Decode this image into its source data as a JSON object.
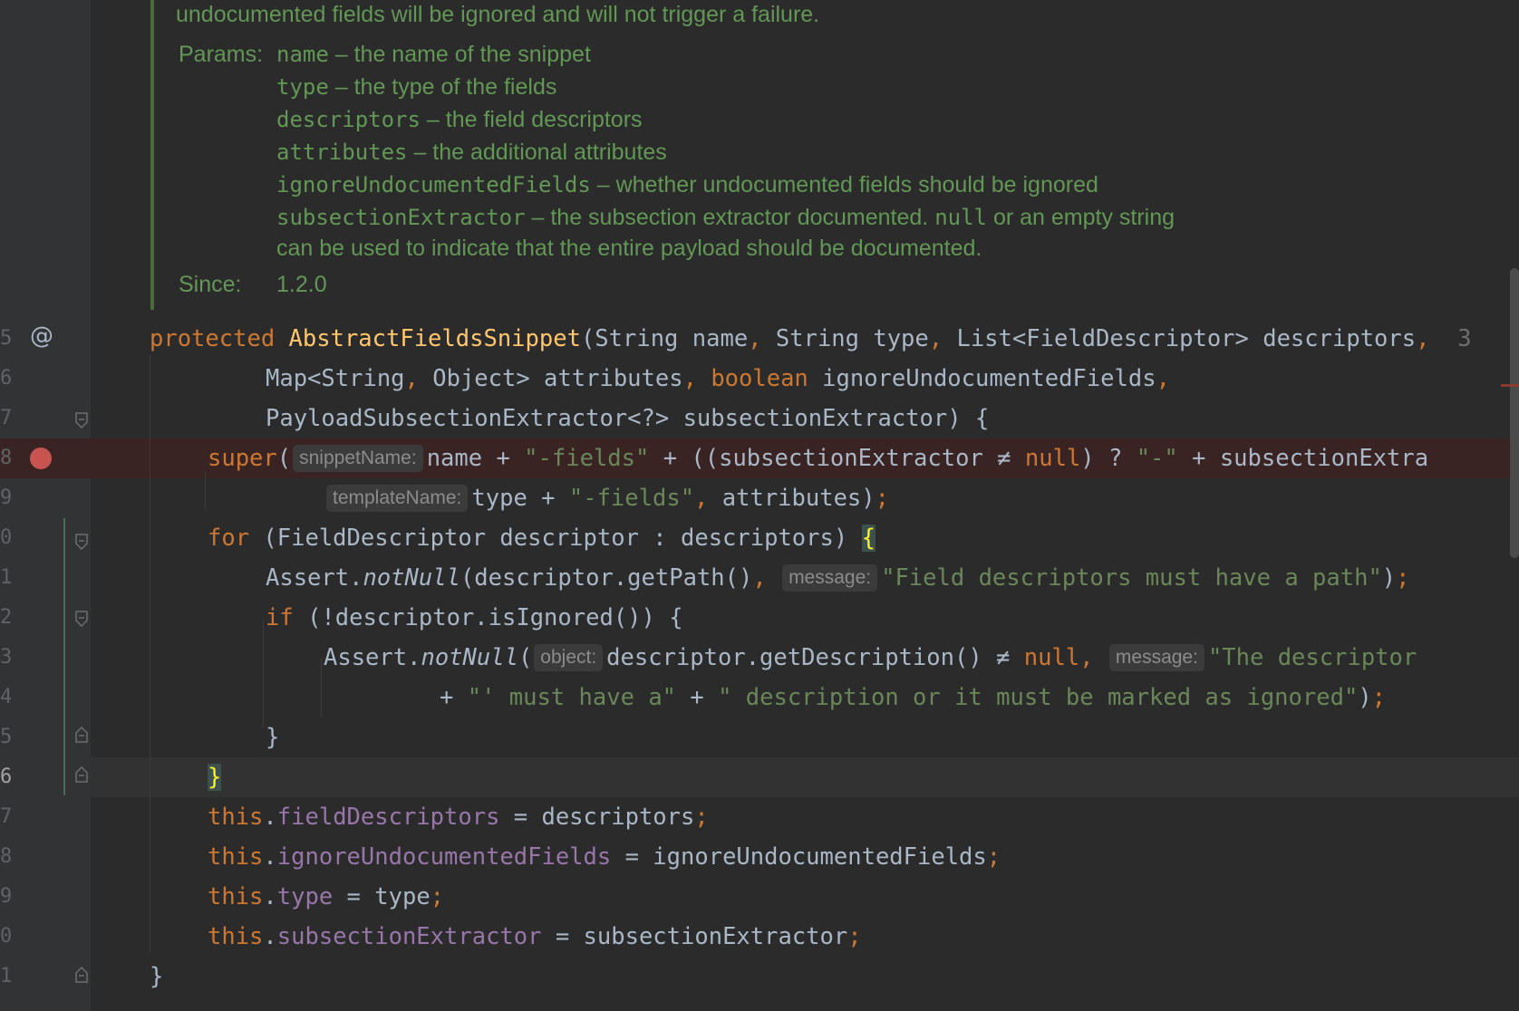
{
  "doc": {
    "line0": "undocumented fields will be ignored and will not trigger a failure.",
    "params_label": "Params:",
    "params": [
      {
        "name": "name",
        "desc": " – the name of the snippet"
      },
      {
        "name": "type",
        "desc": " – the type of the fields"
      },
      {
        "name": "descriptors",
        "desc": " – the field descriptors"
      },
      {
        "name": "attributes",
        "desc": " – the additional attributes"
      },
      {
        "name": "ignoreUndocumentedFields",
        "desc": " – whether undocumented fields should be ignored"
      },
      {
        "name": "subsectionExtractor",
        "desc": " – the subsection extractor documented. "
      }
    ],
    "null_word": "null",
    "after_null": " or an empty string",
    "continuation": "can be used to indicate that the entire payload should be documented.",
    "since_label": "Since:",
    "since_value": "1.2.0"
  },
  "gutter": {
    "line_numbers": [
      "5",
      "6",
      "7",
      "8",
      "9",
      "0",
      "1",
      "2",
      "3",
      "4",
      "5",
      "6",
      "7",
      "8",
      "9",
      "0",
      "1"
    ],
    "current_line_number": "6",
    "override_marker": "@"
  },
  "code": {
    "l1": {
      "kw": "protected",
      "fn": "AbstractFieldsSnippet",
      "a": "(String name",
      "c1": ",",
      "b": " String type",
      "c2": ",",
      "c": " List<FieldDescriptor> descriptors",
      "c3": ",",
      "hint_trunc": "3"
    },
    "l2": {
      "a": "Map<String",
      "c1": ",",
      "b": " Object> attributes",
      "c2": ",",
      "kw": "boolean",
      "c": " ignoreUndocumentedFields",
      "c3": ","
    },
    "l3": {
      "a": "PayloadSubsectionExtractor<?> subsectionExtractor) {"
    },
    "l4": {
      "kw": "super",
      "a": "(",
      "hint": "snippetName:",
      "b": "name + ",
      "s1": "\"-fields\"",
      "c": " + ((subsectionExtractor ≠ ",
      "kw2": "null",
      "d": ") ? ",
      "s2": "\"-\"",
      "e": " + subsectionExtra"
    },
    "l5": {
      "hint": "templateName:",
      "a": "type + ",
      "s1": "\"-fields\"",
      "c1": ",",
      "b": " attributes)",
      "semi": ";"
    },
    "l6": {
      "kw": "for",
      "a": " (FieldDescriptor descriptor : descriptors) ",
      "brace": "{"
    },
    "l7": {
      "a": "Assert.",
      "m": "notNull",
      "b": "(descriptor.getPath()",
      "c1": ",",
      "hint": "message:",
      "s1": "\"Field descriptors must have a path\"",
      "c": ")",
      "semi": ";"
    },
    "l8": {
      "kw": "if",
      "a": " (!descriptor.isIgnored()) {"
    },
    "l9": {
      "a": "Assert.",
      "m": "notNull",
      "b": "(",
      "hint": "object:",
      "c": "descriptor.getDescription() ≠ ",
      "kw2": "null",
      "c1": ",",
      "hint2": "message:",
      "s1": "\"The descriptor"
    },
    "l10": {
      "a": "+ ",
      "s1": "\"'",
      "s2": " must have a\"",
      "b": " + ",
      "s3": "\" description or it must be marked as ignored\"",
      "c": ")",
      "semi": ";"
    },
    "l11": {
      "a": "}"
    },
    "l12": {
      "brace": "}"
    },
    "l13": {
      "kw": "this",
      "dot": ".",
      "fld": "fieldDescriptors",
      "a": " = descriptors",
      "semi": ";"
    },
    "l14": {
      "kw": "this",
      "dot": ".",
      "fld": "ignoreUndocumentedFields",
      "a": " = ignoreUndocumentedFields",
      "semi": ";"
    },
    "l15": {
      "kw": "this",
      "dot": ".",
      "fld": "type",
      "a": " = type",
      "semi": ";"
    },
    "l16": {
      "kw": "this",
      "dot": ".",
      "fld": "subsectionExtractor",
      "a": " = subsectionExtractor",
      "semi": ";"
    },
    "l17": {
      "a": "}"
    }
  }
}
